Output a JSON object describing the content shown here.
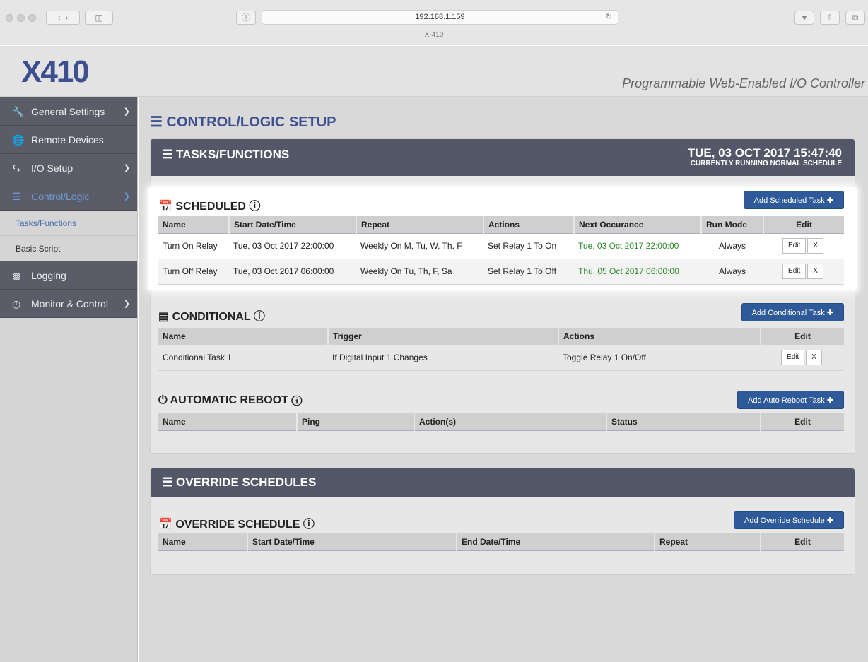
{
  "browser": {
    "url": "192.168.1.159",
    "tab_title": "X-410"
  },
  "header": {
    "logo_text": "X410",
    "tagline": "Programmable Web-Enabled I/O Controller"
  },
  "sidebar": {
    "items": [
      {
        "label": "General Settings"
      },
      {
        "label": "Remote Devices"
      },
      {
        "label": "I/O Setup"
      },
      {
        "label": "Control/Logic"
      },
      {
        "label": "Logging"
      },
      {
        "label": "Monitor & Control"
      }
    ],
    "sub_items": [
      {
        "label": "Tasks/Functions"
      },
      {
        "label": "Basic Script"
      }
    ]
  },
  "main": {
    "page_title": "CONTROL/LOGIC SETUP",
    "tasks_panel": {
      "title": "TASKS/FUNCTIONS",
      "datetime": "TUE, 03 OCT 2017 15:47:40",
      "status": "CURRENTLY RUNNING NORMAL SCHEDULE"
    },
    "scheduled": {
      "title": "SCHEDULED",
      "add_label": "Add Scheduled Task",
      "columns": [
        "Name",
        "Start Date/Time",
        "Repeat",
        "Actions",
        "Next Occurance",
        "Run Mode",
        "Edit"
      ],
      "rows": [
        {
          "name": "Turn On Relay",
          "start": "Tue, 03 Oct 2017 22:00:00",
          "repeat": "Weekly On M, Tu, W, Th, F",
          "actions": "Set Relay 1 To On",
          "next": "Tue, 03 Oct 2017 22:00:00",
          "mode": "Always"
        },
        {
          "name": "Turn Off Relay",
          "start": "Tue, 03 Oct 2017 06:00:00",
          "repeat": "Weekly On Tu, Th, F, Sa",
          "actions": "Set Relay 1 To Off",
          "next": "Thu, 05 Oct 2017 06:00:00",
          "mode": "Always"
        }
      ]
    },
    "conditional": {
      "title": "CONDITIONAL",
      "add_label": "Add Conditional Task",
      "columns": [
        "Name",
        "Trigger",
        "Actions",
        "Edit"
      ],
      "rows": [
        {
          "name": "Conditional Task 1",
          "trigger": "If Digital Input 1 Changes",
          "actions": "Toggle Relay 1 On/Off"
        }
      ]
    },
    "reboot": {
      "title": "AUTOMATIC REBOOT",
      "add_label": "Add Auto Reboot Task",
      "columns": [
        "Name",
        "Ping",
        "Action(s)",
        "Status",
        "Edit"
      ]
    },
    "override_panel": {
      "title": "OVERRIDE SCHEDULES"
    },
    "override": {
      "title": "OVERRIDE SCHEDULE",
      "add_label": "Add Override Schedule",
      "columns": [
        "Name",
        "Start Date/Time",
        "End Date/Time",
        "Repeat",
        "Edit"
      ]
    },
    "edit_label": "Edit",
    "delete_label": "X"
  },
  "colors": {
    "accent": "#2f5a9a",
    "panel_header": "#535768",
    "next_occurrence": "#2b8a2b"
  }
}
